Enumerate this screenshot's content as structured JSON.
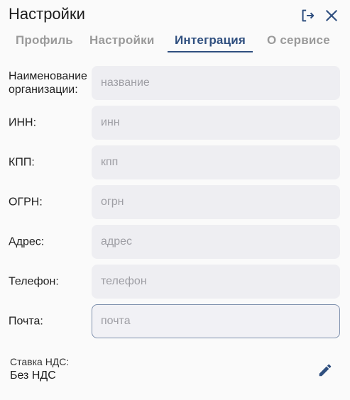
{
  "header": {
    "title": "Настройки",
    "icons": {
      "logout": "logout-icon",
      "close": "close-icon"
    }
  },
  "tabs": [
    {
      "label": "Профиль",
      "active": false
    },
    {
      "label": "Настройки",
      "active": false
    },
    {
      "label": "Интеграция",
      "active": true
    },
    {
      "label": "О сервисе",
      "active": false
    }
  ],
  "form": {
    "fields": [
      {
        "label": "Наименование организации:",
        "placeholder": "название",
        "value": ""
      },
      {
        "label": "ИНН:",
        "placeholder": "инн",
        "value": ""
      },
      {
        "label": "КПП:",
        "placeholder": "кпп",
        "value": ""
      },
      {
        "label": "ОГРН:",
        "placeholder": "огрн",
        "value": ""
      },
      {
        "label": "Адрес:",
        "placeholder": "адрес",
        "value": ""
      },
      {
        "label": "Телефон:",
        "placeholder": "телефон",
        "value": ""
      },
      {
        "label": "Почта:",
        "placeholder": "почта",
        "value": "",
        "focused": true
      }
    ]
  },
  "vat": {
    "label": "Ставка НДС:",
    "value": "Без НДС",
    "edit_icon": "pencil-icon"
  },
  "colors": {
    "accent": "#2f4f7f",
    "inactive_tab": "#9a9a9a",
    "field_bg": "#eeeef2",
    "focus_border": "#7e90ad",
    "background": "#fafafa"
  }
}
